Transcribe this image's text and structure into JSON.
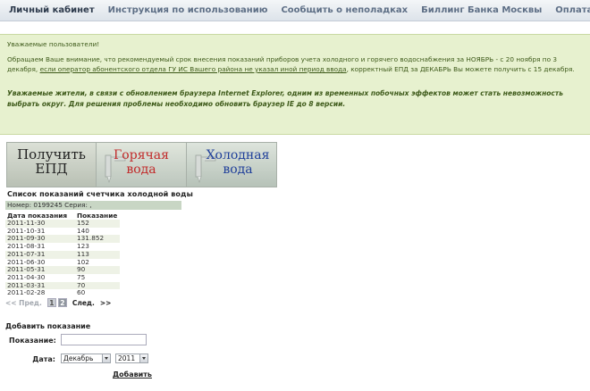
{
  "nav": [
    {
      "label": "Личный кабинет",
      "active": true
    },
    {
      "label": "Инструкция по использованию",
      "active": false
    },
    {
      "label": "Сообщить о неполадках",
      "active": false
    },
    {
      "label": "Биллинг Банка Москвы",
      "active": false
    },
    {
      "label": "Оплата ЕПД",
      "active": false
    }
  ],
  "notice": {
    "greeting": "Уважаемые пользователи!",
    "body_start": "Обращаем Ваше внимание, что рекомендуемый срок внесения показаний приборов учета холодного и горячего водоснабжения за НОЯБРЬ - с 20 ноября по 3 декабря, ",
    "body_underlined": "если оператор абонентского отдела ГУ ИС Вашего района не указал иной период ввода",
    "body_end": ", корректный ЕПД за ДЕКАБРЬ Вы можете получить с 15 декабря.",
    "warning": "Уважаемые жители, в связи с обновлением браузера Internet Explorer, одним из временных побочных эффектов может стать невозможность выбрать округ. Для решения проблемы необходимо обновить браузер IE до 8 версии."
  },
  "tiles": {
    "epd": {
      "line1": "Получить",
      "line2": "ЕПД"
    },
    "hot": {
      "line1": "Горячая",
      "line2": "вода"
    },
    "cold": {
      "line1": "Холодная",
      "line2": "вода"
    }
  },
  "readings": {
    "title": "Список показаний счетчика холодной воды",
    "meter": "Номер: 0199245 Серия: ,",
    "headers": [
      "Дата показания",
      "Показание"
    ],
    "rows": [
      [
        "2011-11-30",
        "152"
      ],
      [
        "2011-10-31",
        "140"
      ],
      [
        "2011-09-30",
        "131.852"
      ],
      [
        "2011-08-31",
        "123"
      ],
      [
        "2011-07-31",
        "113"
      ],
      [
        "2011-06-30",
        "102"
      ],
      [
        "2011-05-31",
        "90"
      ],
      [
        "2011-04-30",
        "75"
      ],
      [
        "2011-03-31",
        "70"
      ],
      [
        "2011-02-28",
        "60"
      ]
    ]
  },
  "pager": {
    "prev": "<< Пред.",
    "pages": [
      "1",
      "2"
    ],
    "next": "След.",
    "last": ">>"
  },
  "add_form": {
    "title": "Добавить показание",
    "reading_label": "Показание:",
    "reading_value": "",
    "date_label": "Дата:",
    "month_selected": "Декабрь",
    "year_selected": "2011",
    "submit": "Добавить"
  }
}
